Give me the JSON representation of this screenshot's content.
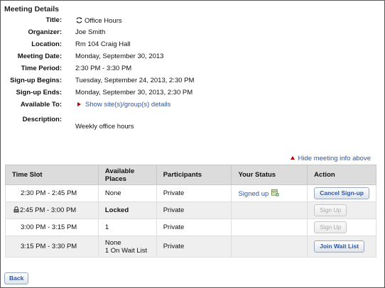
{
  "section_title": "Meeting Details",
  "details": [
    {
      "key": "title",
      "label": "Title:",
      "value": "Office Hours",
      "icon": "refresh-icon"
    },
    {
      "key": "organizer",
      "label": "Organizer:",
      "value": "Joe Smith"
    },
    {
      "key": "location",
      "label": "Location:",
      "value": "Rm 104 Craig Hall"
    },
    {
      "key": "meeting_date",
      "label": "Meeting Date:",
      "value": "Monday, September 30, 2013"
    },
    {
      "key": "time_period",
      "label": "Time Period:",
      "value": "2:30 PM  -  3:30 PM"
    },
    {
      "key": "signup_begins",
      "label": "Sign-up Begins:",
      "value": "Tuesday, September 24, 2013, 2:30 PM"
    },
    {
      "key": "signup_ends",
      "label": "Sign-up Ends:",
      "value": "Monday, September 30, 2013, 2:30 PM"
    },
    {
      "key": "available_to",
      "label": "Available To:",
      "value": "Show site(s)/group(s) details",
      "icon": "expand-triangle-icon"
    },
    {
      "key": "description",
      "label": "Description:",
      "value": "Weekly office hours"
    }
  ],
  "hide_link": "Hide meeting info above",
  "table": {
    "headers": [
      "Time Slot",
      "Available Places",
      "Participants",
      "Your Status",
      "Action"
    ],
    "rows": [
      {
        "time": "2:30 PM  -  2:45 PM",
        "places": "None",
        "places2": "",
        "participants": "Private",
        "status": "Signed up",
        "action": "Cancel Sign-up",
        "action_enabled": true,
        "locked": false
      },
      {
        "time": "2:45 PM  -  3:00 PM",
        "places": "Locked",
        "places2": "",
        "participants": "Private",
        "status": "",
        "action": "Sign Up",
        "action_enabled": false,
        "locked": true
      },
      {
        "time": "3:00 PM  -  3:15 PM",
        "places": "1",
        "places2": "",
        "participants": "Private",
        "status": "",
        "action": "Sign Up",
        "action_enabled": false,
        "locked": false
      },
      {
        "time": "3:15 PM  -  3:30 PM",
        "places": "None",
        "places2": "1 On Wait List",
        "participants": "Private",
        "status": "",
        "action": "Join Wait List",
        "action_enabled": true,
        "locked": false
      }
    ]
  },
  "back_label": "Back",
  "colors": {
    "link": "#2b55a8",
    "triangle": "#b00000",
    "header_bg": "#dcdcdc",
    "alt_row_bg": "#efefef"
  }
}
